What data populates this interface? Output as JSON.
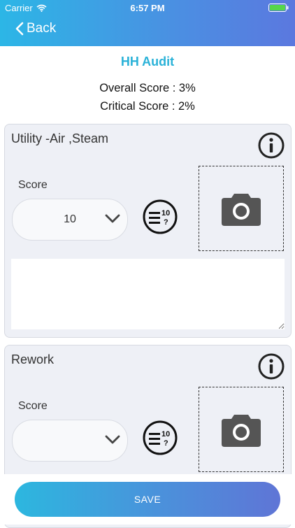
{
  "status_bar": {
    "carrier": "Carrier",
    "time": "6:57 PM"
  },
  "nav": {
    "back_label": "Back"
  },
  "page": {
    "title": "HH Audit",
    "overall_score": "Overall Score : 3%",
    "critical_score": "Critical Score : 2%"
  },
  "cards": [
    {
      "title": "Utility -Air ,Steam",
      "score_label": "Score",
      "score_value": "10"
    },
    {
      "title": "Rework",
      "score_label": "Score",
      "score_value": ""
    }
  ],
  "scale_icon": {
    "top": "10",
    "bottom": "?"
  },
  "actions": {
    "save_label": "SAVE"
  },
  "colors": {
    "header_start": "#2cb6e6",
    "header_end": "#5b78df",
    "title_accent": "#2ab2d8"
  },
  "icons": [
    "wifi-icon",
    "battery-icon",
    "chevron-left-icon",
    "info-icon",
    "chevron-down-icon",
    "score-scale-icon",
    "camera-icon"
  ]
}
